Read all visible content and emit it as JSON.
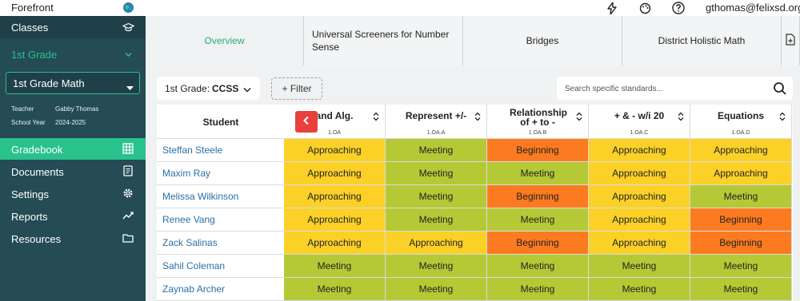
{
  "app": {
    "brand": "Forefront",
    "user_email": "gthomas@felixsd.org"
  },
  "sidebar": {
    "section_title": "Classes",
    "grade": "1st Grade",
    "class_name": "1st Grade Math",
    "teacher_label": "Teacher",
    "teacher_value": "Gabby Thomas",
    "year_label": "School Year",
    "year_value": "2024-2025",
    "nav": [
      {
        "label": "Gradebook",
        "icon": "grid-icon",
        "active": true
      },
      {
        "label": "Documents",
        "icon": "document-icon"
      },
      {
        "label": "Settings",
        "icon": "gear-icon"
      },
      {
        "label": "Reports",
        "icon": "trend-icon"
      },
      {
        "label": "Resources",
        "icon": "folder-icon"
      }
    ]
  },
  "tabs": [
    {
      "label": "Overview",
      "active": true
    },
    {
      "label": "Universal Screeners for Number Sense"
    },
    {
      "label": "Bridges"
    },
    {
      "label": "District Holistic Math"
    }
  ],
  "filters": {
    "grade_prefix": "1st Grade:",
    "grade_value": "CCSS",
    "filter_label": "+ Filter",
    "search_placeholder": "Search specific standards..."
  },
  "table": {
    "student_header": "Student",
    "columns": [
      {
        "label": "and Alg.",
        "code": "1.OA"
      },
      {
        "label": "Represent +/-",
        "code": "1.OA.A"
      },
      {
        "label": "Relationship of + to -",
        "code": "1.OA.B"
      },
      {
        "label": "+ & - w/i 20",
        "code": "1.OA.C"
      },
      {
        "label": "Equations",
        "code": "1.OA.D"
      }
    ],
    "rows": [
      {
        "student": "Steffan Steele",
        "levels": [
          "Approaching",
          "Meeting",
          "Beginning",
          "Approaching",
          "Approaching"
        ]
      },
      {
        "student": "Maxim Ray",
        "levels": [
          "Approaching",
          "Meeting",
          "Meeting",
          "Approaching",
          "Approaching"
        ]
      },
      {
        "student": "Melissa Wilkinson",
        "levels": [
          "Approaching",
          "Meeting",
          "Beginning",
          "Approaching",
          "Meeting"
        ]
      },
      {
        "student": "Renee Vang",
        "levels": [
          "Approaching",
          "Meeting",
          "Meeting",
          "Approaching",
          "Beginning"
        ]
      },
      {
        "student": "Zack Salinas",
        "levels": [
          "Approaching",
          "Approaching",
          "Beginning",
          "Approaching",
          "Beginning"
        ]
      },
      {
        "student": "Sahil Coleman",
        "levels": [
          "Meeting",
          "Meeting",
          "Meeting",
          "Meeting",
          "Meeting"
        ]
      },
      {
        "student": "Zaynab Archer",
        "levels": [
          "Meeting",
          "Meeting",
          "Meeting",
          "Meeting",
          "Meeting"
        ]
      }
    ]
  },
  "level_colors": {
    "Approaching": "#fbd128",
    "Meeting": "#b5c936",
    "Beginning": "#fc7b20"
  },
  "colors": {
    "sidebar": "#254b55",
    "accent": "#29c28c",
    "collapse_button": "#e8403c"
  }
}
